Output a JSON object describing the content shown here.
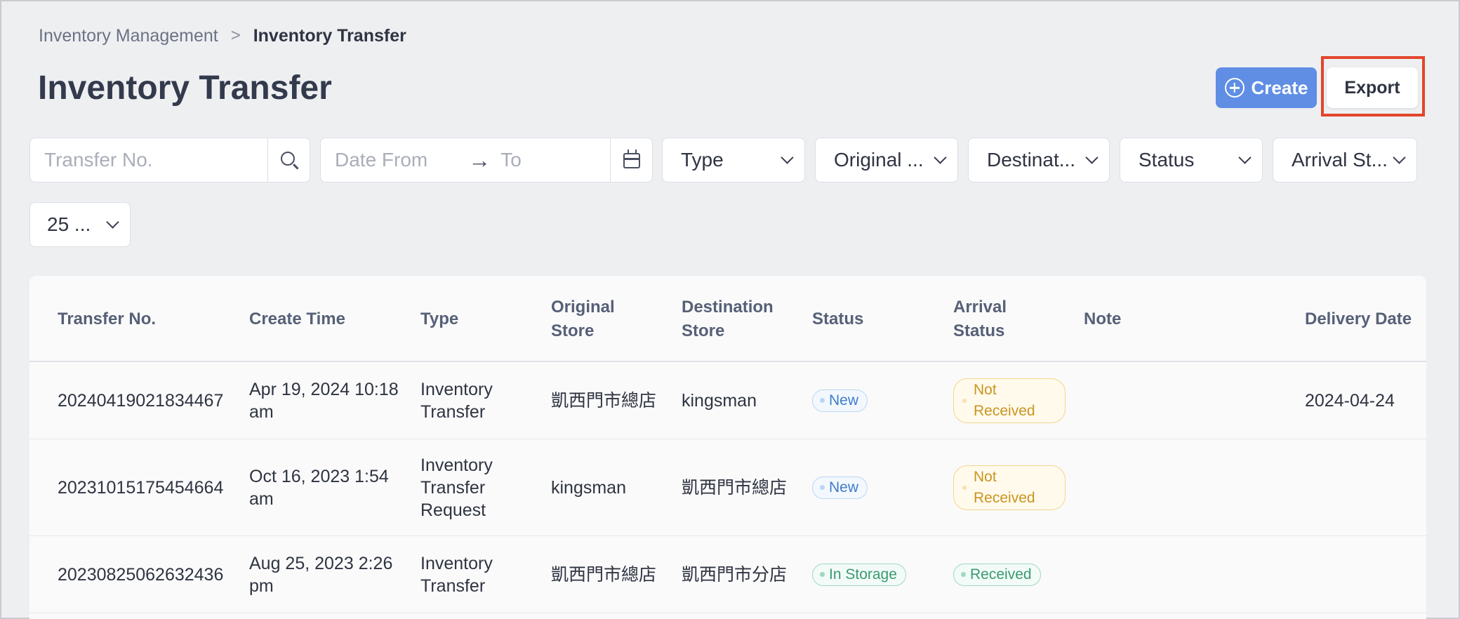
{
  "breadcrumb": {
    "parent": "Inventory Management",
    "separator": ">",
    "current": "Inventory Transfer"
  },
  "page": {
    "title": "Inventory Transfer"
  },
  "actions": {
    "create_label": "Create",
    "export_label": "Export"
  },
  "filters": {
    "transfer_no_placeholder": "Transfer No.",
    "date_from_placeholder": "Date From",
    "date_arrow": "→",
    "date_to_placeholder": "To",
    "type": "Type",
    "original_store": "Original ...",
    "destination_store": "Destinat...",
    "status": "Status",
    "arrival_status": "Arrival St...",
    "page_size": "25 ..."
  },
  "table": {
    "headers": {
      "transfer_no": "Transfer No.",
      "create_time": "Create Time",
      "type": "Type",
      "original_store": "Original Store",
      "destination_store": "Destination Store",
      "status": "Status",
      "arrival_status": "Arrival Status",
      "note": "Note",
      "delivery_date": "Delivery Date"
    },
    "rows": [
      {
        "transfer_no": "20240419021834467",
        "create_time": "Apr 19, 2024 10:18 am",
        "type": "Inventory Transfer",
        "original_store": "凱西門市總店",
        "destination_store": "kingsman",
        "status": "New",
        "arrival_status": "Not Received",
        "note": "",
        "delivery_date": "2024-04-24"
      },
      {
        "transfer_no": "20231015175454664",
        "create_time": "Oct 16, 2023 1:54 am",
        "type": "Inventory Transfer Request",
        "original_store": "kingsman",
        "destination_store": "凱西門市總店",
        "status": "New",
        "arrival_status": "Not Received",
        "note": "",
        "delivery_date": ""
      },
      {
        "transfer_no": "20230825062632436",
        "create_time": "Aug 25, 2023 2:26 pm",
        "type": "Inventory Transfer",
        "original_store": "凱西門市總店",
        "destination_store": "凱西門市分店",
        "status": "In Storage",
        "arrival_status": "Received",
        "note": "",
        "delivery_date": ""
      }
    ]
  },
  "colors": {
    "primary": "#5f8ee4",
    "highlight": "#e2462b",
    "status_new": "#3f7cc9",
    "status_in_storage": "#3a9a72",
    "arrival_not_received": "#c9951f"
  }
}
